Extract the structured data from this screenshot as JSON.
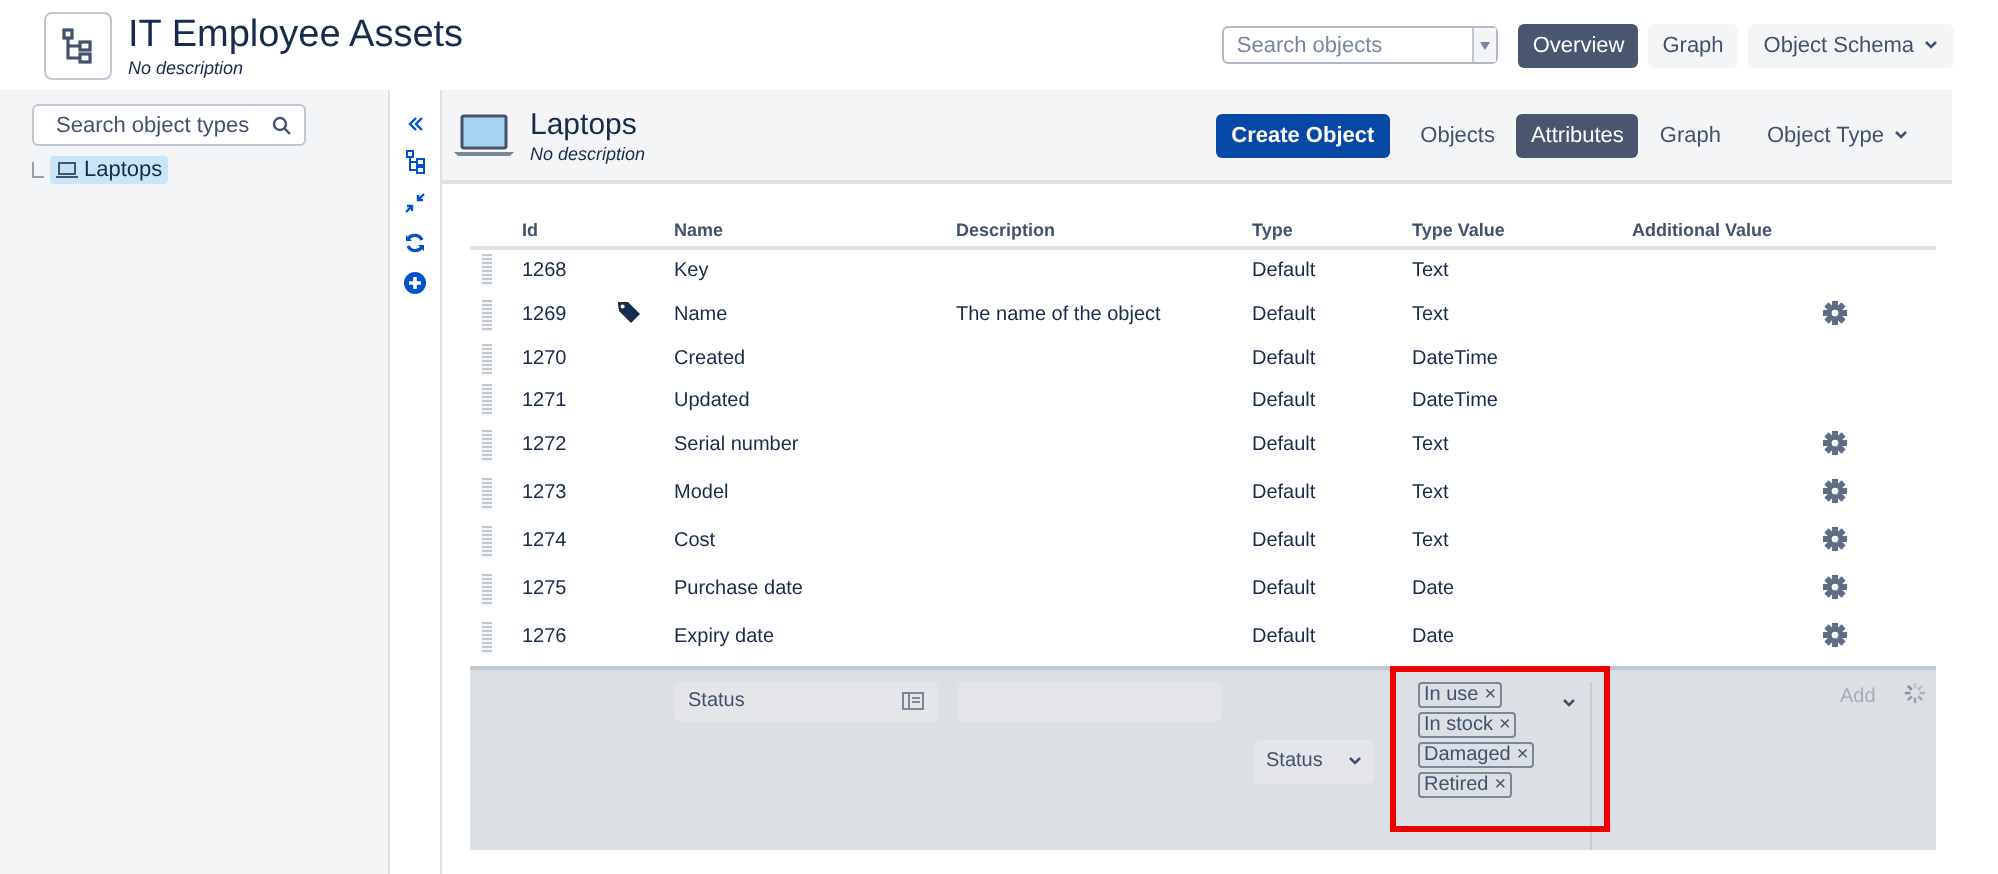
{
  "schema": {
    "title": "IT Employee Assets",
    "description": "No description"
  },
  "header": {
    "search": {
      "placeholder": "Search objects"
    },
    "tabs": [
      {
        "label": "Overview",
        "selected": true
      },
      {
        "label": "Graph",
        "selected": false
      }
    ],
    "menu": "Object Schema"
  },
  "sidebar": {
    "search": {
      "placeholder": "Search object types"
    },
    "tree": [
      {
        "label": "Laptops",
        "selected": true
      }
    ]
  },
  "object_type": {
    "title": "Laptops",
    "description": "No description",
    "create_button": "Create Object",
    "tabs": [
      {
        "label": "Objects",
        "selected": false
      },
      {
        "label": "Attributes",
        "selected": true
      },
      {
        "label": "Graph",
        "selected": false
      }
    ],
    "menu": "Object Type"
  },
  "table": {
    "columns": [
      "Id",
      "Name",
      "Description",
      "Type",
      "Type Value",
      "Additional Value"
    ],
    "rows": [
      {
        "id": "1268",
        "name": "Key",
        "description": "",
        "type": "Default",
        "type_value": "Text",
        "label": false,
        "configurable": false
      },
      {
        "id": "1269",
        "name": "Name",
        "description": "The name of the object",
        "type": "Default",
        "type_value": "Text",
        "label": true,
        "configurable": true
      },
      {
        "id": "1270",
        "name": "Created",
        "description": "",
        "type": "Default",
        "type_value": "DateTime",
        "label": false,
        "configurable": false
      },
      {
        "id": "1271",
        "name": "Updated",
        "description": "",
        "type": "Default",
        "type_value": "DateTime",
        "label": false,
        "configurable": false
      },
      {
        "id": "1272",
        "name": "Serial number",
        "description": "",
        "type": "Default",
        "type_value": "Text",
        "label": false,
        "configurable": true
      },
      {
        "id": "1273",
        "name": "Model",
        "description": "",
        "type": "Default",
        "type_value": "Text",
        "label": false,
        "configurable": true
      },
      {
        "id": "1274",
        "name": "Cost",
        "description": "",
        "type": "Default",
        "type_value": "Text",
        "label": false,
        "configurable": true
      },
      {
        "id": "1275",
        "name": "Purchase date",
        "description": "",
        "type": "Default",
        "type_value": "Date",
        "label": false,
        "configurable": true
      },
      {
        "id": "1276",
        "name": "Expiry date",
        "description": "",
        "type": "Default",
        "type_value": "Date",
        "label": false,
        "configurable": true
      }
    ]
  },
  "new_attribute": {
    "name": "Status",
    "type": "Status",
    "type_values": [
      {
        "label": "In use",
        "remove": "×"
      },
      {
        "label": "In stock",
        "remove": "×"
      },
      {
        "label": "Damaged",
        "remove": "×"
      },
      {
        "label": "Retired",
        "remove": "×"
      }
    ],
    "add_button": "Add",
    "highlighted": true
  }
}
